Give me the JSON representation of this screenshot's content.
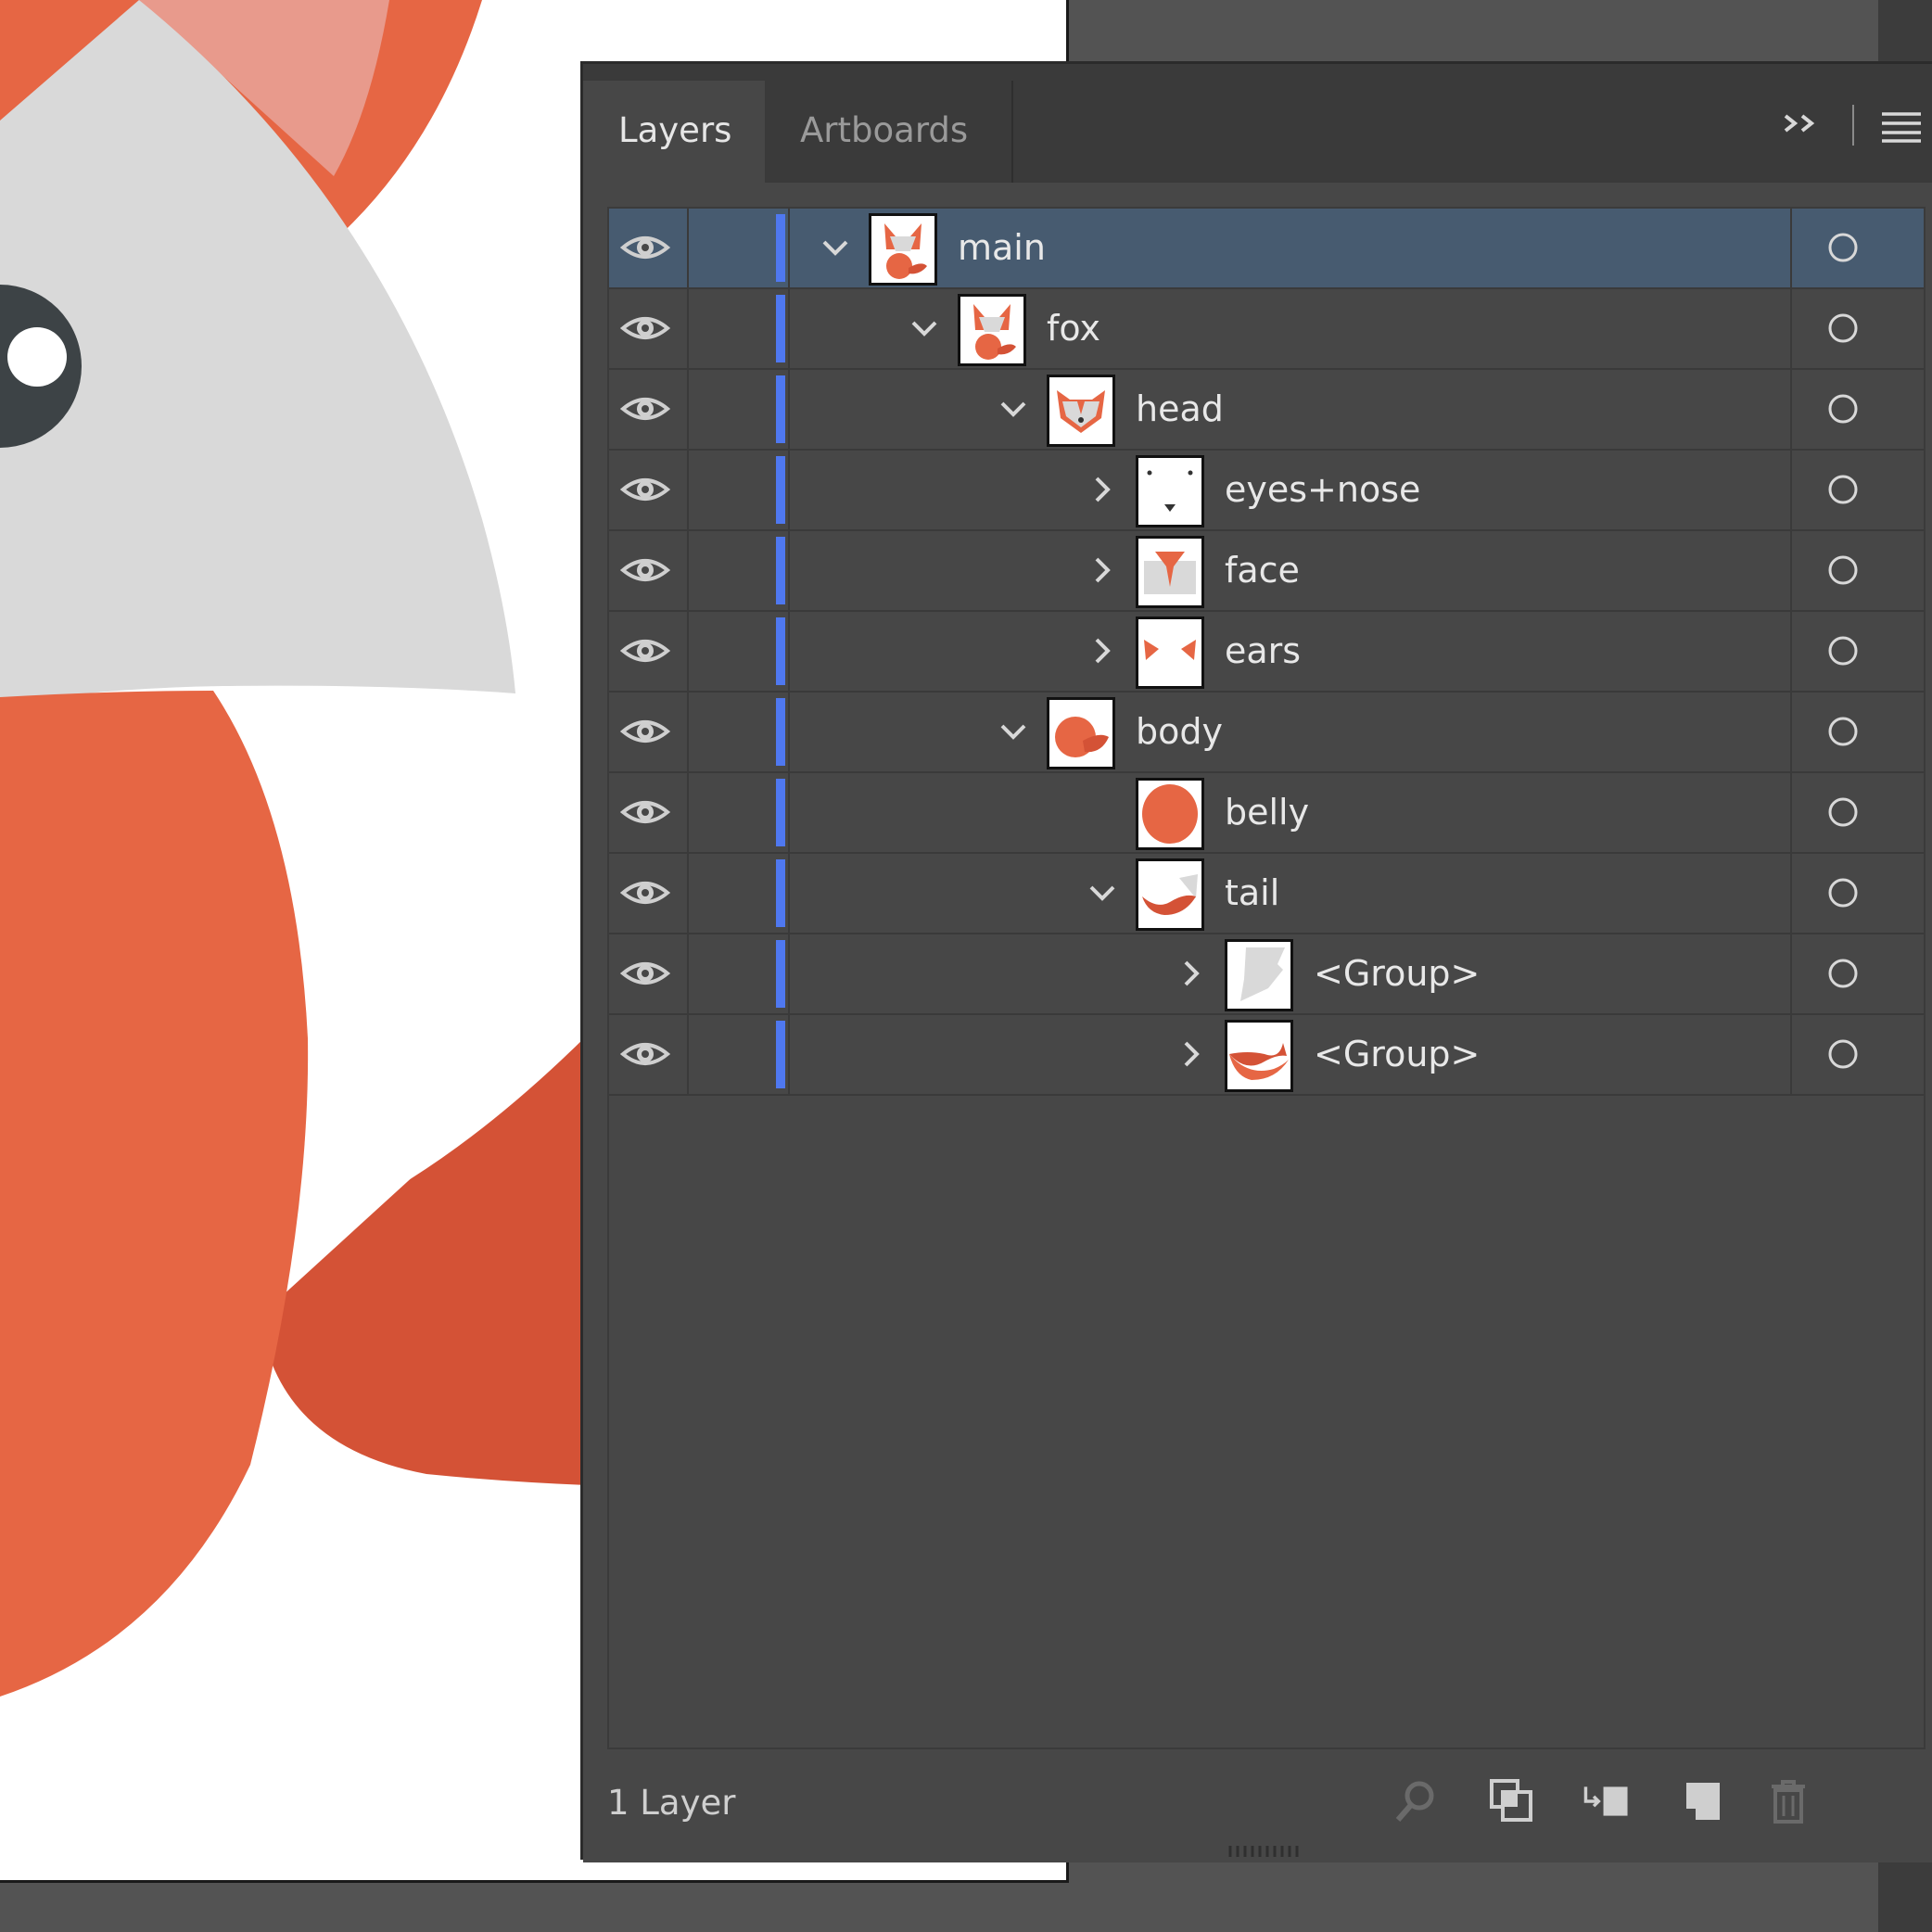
{
  "panel": {
    "tabs": [
      {
        "label": "Layers",
        "active": true
      },
      {
        "label": "Artboards",
        "active": false
      }
    ],
    "collapse_icon": "double-chevron-right-icon",
    "menu_icon": "hamburger-menu-icon"
  },
  "layers": [
    {
      "name": "main",
      "depth": 0,
      "expanded": true,
      "has_children": true,
      "selected": true,
      "thumb": "fox-thumb"
    },
    {
      "name": "fox",
      "depth": 1,
      "expanded": true,
      "has_children": true,
      "selected": false,
      "thumb": "fox-thumb"
    },
    {
      "name": "head",
      "depth": 2,
      "expanded": true,
      "has_children": true,
      "selected": false,
      "thumb": "head-thumb"
    },
    {
      "name": "eyes+nose",
      "depth": 3,
      "expanded": false,
      "has_children": true,
      "selected": false,
      "thumb": "eyes-thumb"
    },
    {
      "name": "face",
      "depth": 3,
      "expanded": false,
      "has_children": true,
      "selected": false,
      "thumb": "face-thumb"
    },
    {
      "name": "ears",
      "depth": 3,
      "expanded": false,
      "has_children": true,
      "selected": false,
      "thumb": "ears-thumb"
    },
    {
      "name": "body",
      "depth": 2,
      "expanded": true,
      "has_children": true,
      "selected": false,
      "thumb": "body-thumb"
    },
    {
      "name": "belly",
      "depth": 3,
      "expanded": false,
      "has_children": false,
      "selected": false,
      "thumb": "belly-thumb"
    },
    {
      "name": "tail",
      "depth": 3,
      "expanded": true,
      "has_children": true,
      "selected": false,
      "thumb": "tail-thumb"
    },
    {
      "name": "<Group>",
      "depth": 4,
      "expanded": false,
      "has_children": true,
      "selected": false,
      "thumb": "group-grey-thumb"
    },
    {
      "name": "<Group>",
      "depth": 4,
      "expanded": false,
      "has_children": true,
      "selected": false,
      "thumb": "group-orange-thumb"
    }
  ],
  "footer": {
    "layer_count": "1 Layer",
    "icons": [
      "search-icon",
      "collect-export-icon",
      "make-clipping-mask-icon",
      "new-sublayer-icon",
      "new-layer-icon",
      "delete-icon"
    ]
  },
  "colors": {
    "panel_bg": "#474747",
    "selected_row": "#475b70",
    "layer_color": "#4f78f0",
    "fox_orange": "#e66644",
    "fox_dark_orange": "#d45236",
    "fox_grey": "#d9d9d9"
  }
}
